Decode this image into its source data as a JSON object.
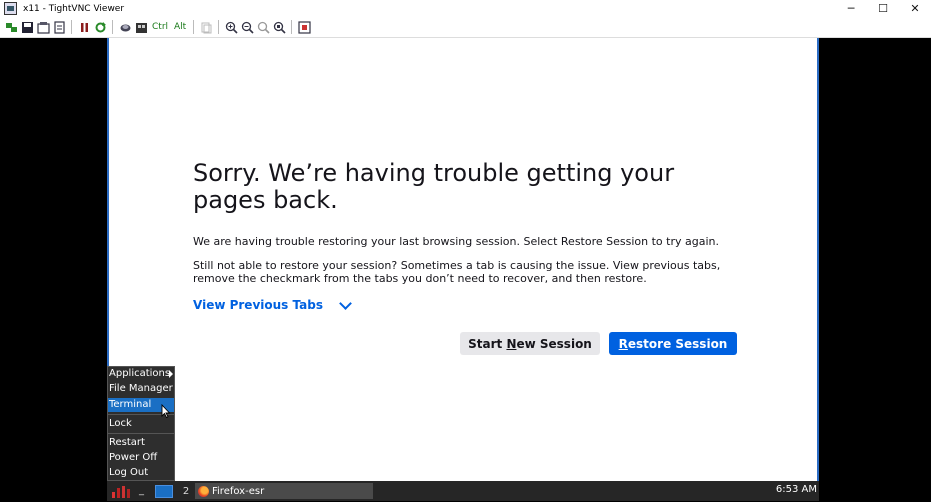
{
  "window": {
    "title": "x11 - TightVNC Viewer",
    "minimize": "─",
    "maximize": "☐",
    "close": "✕"
  },
  "toolbar": {
    "ctrl_label": "Ctrl",
    "alt_label": "Alt"
  },
  "firefox": {
    "heading": "Sorry. We’re having trouble getting your pages back.",
    "para1": "We are having trouble restoring your last browsing session. Select Restore Session to try again.",
    "para2": "Still not able to restore your session? Sometimes a tab is causing the issue. View previous tabs, remove the checkmark from the tabs you don’t need to recover, and then restore.",
    "view_previous_tabs": "View Previous Tabs",
    "start_new_session_pre": "Start ",
    "start_new_session_u": "N",
    "start_new_session_post": "ew Session",
    "restore_session_u": "R",
    "restore_session_post": "estore Session",
    "accent_color": "#0061e0"
  },
  "menu": {
    "items": [
      {
        "label": "Applications"
      },
      {
        "label": "File Manager"
      },
      {
        "label": "Terminal"
      },
      {
        "label": "Lock"
      },
      {
        "label": "Restart"
      },
      {
        "label": "Power Off"
      },
      {
        "label": "Log Out"
      }
    ],
    "selected": "Terminal"
  },
  "taskbar": {
    "underscore": "_",
    "desktop_number": "2",
    "task_label": "Firefox-esr",
    "clock": "6:53 AM"
  }
}
